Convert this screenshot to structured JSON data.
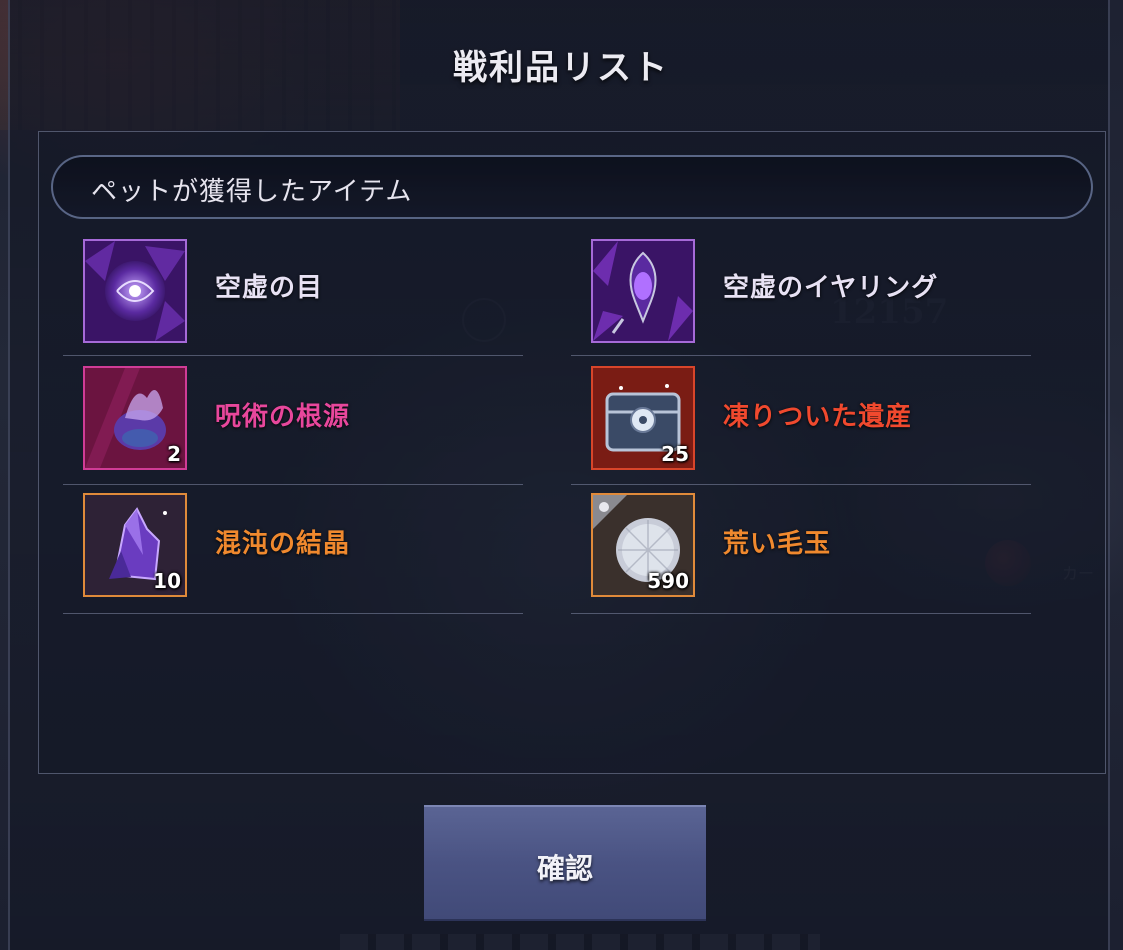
{
  "dialog": {
    "title": "戦利品リスト",
    "section_header": "ペットが獲得したアイテム",
    "confirm_label": "確認"
  },
  "items": [
    {
      "name": "空虚の目",
      "count": "",
      "name_color": "#e8e2f4",
      "icon": "void-eye-icon",
      "frame_color": "#a66ad8",
      "bg_color": "#4a1f78"
    },
    {
      "name": "空虚のイヤリング",
      "count": "",
      "name_color": "#e8e2f4",
      "icon": "void-earring-icon",
      "frame_color": "#a66ad8",
      "bg_color": "#4a1f78"
    },
    {
      "name": "呪術の根源",
      "count": "2",
      "name_color": "#e8479c",
      "icon": "curse-source-icon",
      "frame_color": "#d03c96",
      "bg_color": "#6b1440"
    },
    {
      "name": "凍りついた遺産",
      "count": "25",
      "name_color": "#f0492e",
      "icon": "frozen-heritage-chest-icon",
      "frame_color": "#d8452a",
      "bg_color": "#6a1a12"
    },
    {
      "name": "混沌の結晶",
      "count": "10",
      "name_color": "#f0892e",
      "icon": "chaos-crystal-icon",
      "frame_color": "#e08a3a",
      "bg_color": "#3a2a38"
    },
    {
      "name": "荒い毛玉",
      "count": "590",
      "name_color": "#f0892e",
      "icon": "rough-furball-icon",
      "frame_color": "#e08a3a",
      "bg_color": "#3a2e2a"
    }
  ],
  "background": {
    "number_text": "12157",
    "side_text": "カー"
  }
}
